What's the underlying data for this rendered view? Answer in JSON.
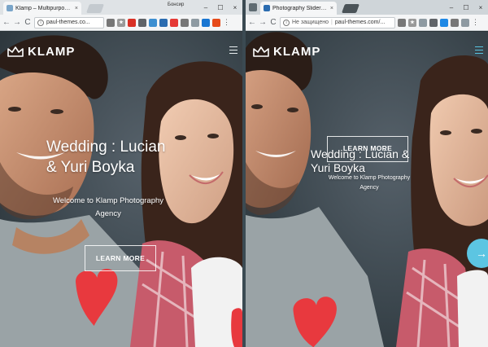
{
  "left_window": {
    "tab_title": "Klamp – Multipurpose H",
    "tab_close": "×",
    "user_label": "Бонсир",
    "url": "paul-themes.co...",
    "nav": {
      "back": "←",
      "forward": "→",
      "reload": "C"
    },
    "logo_text": "KLAMP",
    "headline_line1": "Wedding : Lucian",
    "headline_line2": "& Yuri Boyka",
    "subtitle_line1": "Welcome to Klamp Photography",
    "subtitle_line2": "Agency",
    "button_label": "LEARN MORE"
  },
  "right_window": {
    "tab_title": "Photography Slider – Kl",
    "tab_close": "×",
    "insecure_label": "Не защищено",
    "url": "paul-themes.com/...",
    "nav": {
      "back": "←",
      "forward": "→",
      "reload": "C"
    },
    "logo_text": "KLAMP",
    "headline_line1": "Wedding : Lucian &",
    "headline_line2": "Yuri Boyka",
    "subtitle_line1": "Welcome to Klamp Photography",
    "subtitle_line2": "Agency",
    "button_label": "LEARN MORE",
    "next_arrow": "→"
  },
  "window_controls": {
    "minimize": "–",
    "maximize": "☐",
    "close": "×"
  },
  "colors": {
    "accent": "#5cc5e2",
    "heart": "#e8393e",
    "shirt": "#9aa3a6"
  }
}
